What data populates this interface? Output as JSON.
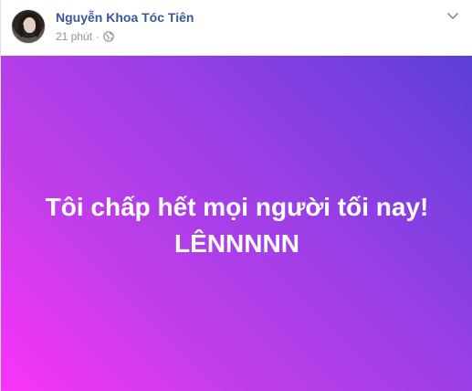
{
  "post": {
    "author_name": "Nguyễn Khoa Tóc Tiên",
    "timestamp": "21 phút",
    "separator": "·",
    "privacy_icon": "globe-icon",
    "menu_icon": "chevron-down-icon",
    "status_line1": "Tôi chấp hết mọi người tối nay!",
    "status_line2": "LÊNNNNN",
    "colors": {
      "name": "#365899",
      "meta": "#90949c",
      "gradient_start": "#fa33f9",
      "gradient_end": "#5b3fd8",
      "status_text": "#ffffff"
    }
  }
}
